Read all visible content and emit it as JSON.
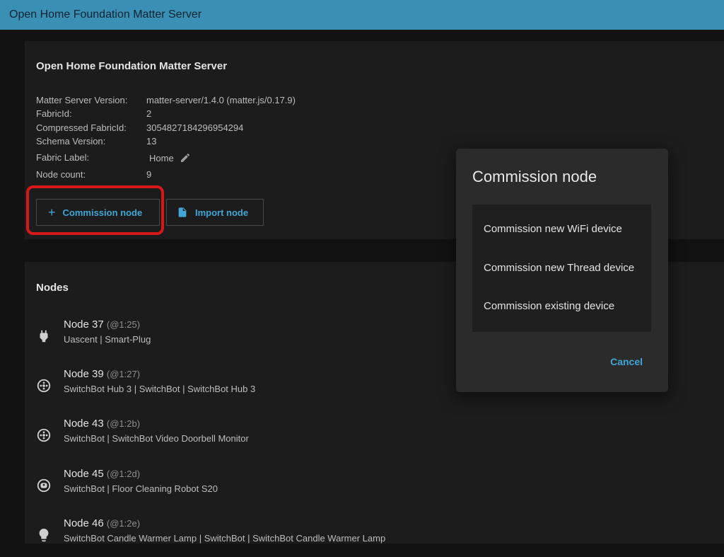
{
  "app": {
    "title": "Open Home Foundation Matter Server",
    "accent_color": "#3a8fb4",
    "link_color": "#40a6d6"
  },
  "server_card": {
    "title": "Open Home Foundation Matter Server",
    "rows": [
      {
        "label": "Matter Server Version:",
        "value": "matter-server/1.4.0 (matter.js/0.17.9)"
      },
      {
        "label": "FabricId:",
        "value": "2"
      },
      {
        "label": "Compressed FabricId:",
        "value": "3054827184296954294"
      },
      {
        "label": "Schema Version:",
        "value": "13"
      },
      {
        "label": "Fabric Label:",
        "value": "Home"
      },
      {
        "label": "Node count:",
        "value": "9"
      }
    ],
    "edit_icon": "pencil-icon",
    "commission_button": {
      "label": "Commission node",
      "icon": "plus-icon"
    },
    "import_button": {
      "label": "Import node",
      "icon": "file-icon"
    }
  },
  "nodes_card": {
    "title": "Nodes",
    "items": [
      {
        "name": "Node 37",
        "address": "(@1:25)",
        "subtitle": "Uascent | Smart-Plug",
        "icon": "power-plug-icon"
      },
      {
        "name": "Node 39",
        "address": "(@1:27)",
        "subtitle": "SwitchBot Hub 3 | SwitchBot | SwitchBot Hub 3",
        "icon": "remote-icon"
      },
      {
        "name": "Node 43",
        "address": "(@1:2b)",
        "subtitle": "SwitchBot | SwitchBot Video Doorbell Monitor",
        "icon": "remote-icon"
      },
      {
        "name": "Node 45",
        "address": "(@1:2d)",
        "subtitle": "SwitchBot | Floor Cleaning Robot S20",
        "icon": "robot-vacuum-icon"
      },
      {
        "name": "Node 46",
        "address": "(@1:2e)",
        "subtitle": "SwitchBot Candle Warmer Lamp | SwitchBot | SwitchBot Candle Warmer Lamp",
        "icon": "lightbulb-icon"
      }
    ]
  },
  "dialog": {
    "title": "Commission node",
    "options": [
      "Commission new WiFi device",
      "Commission new Thread device",
      "Commission existing device"
    ],
    "cancel_label": "Cancel"
  }
}
